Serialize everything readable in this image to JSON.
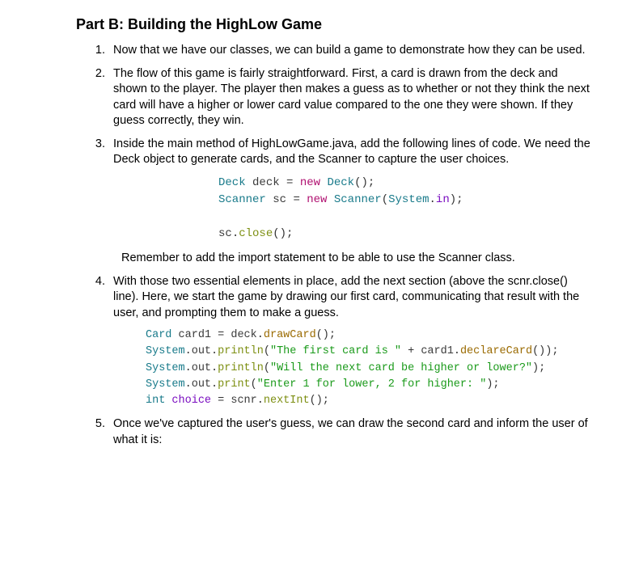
{
  "heading": "Part B: Building the HighLow Game",
  "steps": {
    "s1": "Now that we have our classes, we can build a game to demonstrate how they can be used.",
    "s2": "The flow of this game is fairly straightforward.  First, a card is drawn from the deck and shown to the player.  The player then makes a guess as to whether or not they think the next card will have a higher or lower card value compared to the one they were shown.  If they guess correctly, they win.",
    "s3": "Inside the main method of HighLowGame.java, add the following lines of code.  We need the Deck object to generate cards, and the Scanner to capture the user choices.",
    "s3_remember": "Remember to add the import statement to be able to use the Scanner class.",
    "s4": "With those two essential elements in place, add the next section (above the scnr.close() line).  Here, we start the game by drawing our first card, communicating that result with the user, and prompting them to make a guess.",
    "s5": "Once we've captured the user's guess, we can draw the second card and inform the user of what it is:"
  },
  "code1": {
    "l1": {
      "t_type1": "Deck",
      "t_var": "deck",
      "t_eq": "=",
      "t_kw": "new",
      "t_type2": "Deck",
      "t_rest": "();"
    },
    "l2": {
      "t_type1": "Scanner",
      "t_var": "sc",
      "t_eq": "=",
      "t_kw": "new",
      "t_type2": "Scanner",
      "t_lp": "(",
      "t_sys": "System",
      "t_dot": ".",
      "t_in": "in",
      "t_rp": ");"
    },
    "l3": {
      "t_var": "sc",
      "t_dot": ".",
      "t_close": "close",
      "t_rest": "();"
    }
  },
  "code2": {
    "l1": {
      "t_type": "Card",
      "t_var": "card1",
      "t_eq": "=",
      "t_obj": "deck",
      "t_dot": ".",
      "t_method": "drawCard",
      "t_rest": "();"
    },
    "l2": {
      "t_sys": "System",
      "t_d1": ".",
      "t_out": "out",
      "t_d2": ".",
      "t_pl": "println",
      "t_lp": "(",
      "t_str": "\"The first card is \"",
      "t_plus": " + ",
      "t_obj": "card1",
      "t_d3": ".",
      "t_method": "declareCard",
      "t_rest": "());"
    },
    "l3": {
      "t_sys": "System",
      "t_d1": ".",
      "t_out": "out",
      "t_d2": ".",
      "t_pl": "println",
      "t_lp": "(",
      "t_str": "\"Will the next card be higher or lower?\"",
      "t_rp": ");"
    },
    "l4": {
      "t_sys": "System",
      "t_d1": ".",
      "t_out": "out",
      "t_d2": ".",
      "t_pr": "print",
      "t_lp": "(",
      "t_str": "\"Enter 1 for lower, 2 for higher: \"",
      "t_rp": ");"
    },
    "l5": {
      "t_type": "int",
      "t_var": "choice",
      "t_eq": "=",
      "t_obj": "scnr",
      "t_dot": ".",
      "t_method": "nextInt",
      "t_rest": "();"
    }
  }
}
